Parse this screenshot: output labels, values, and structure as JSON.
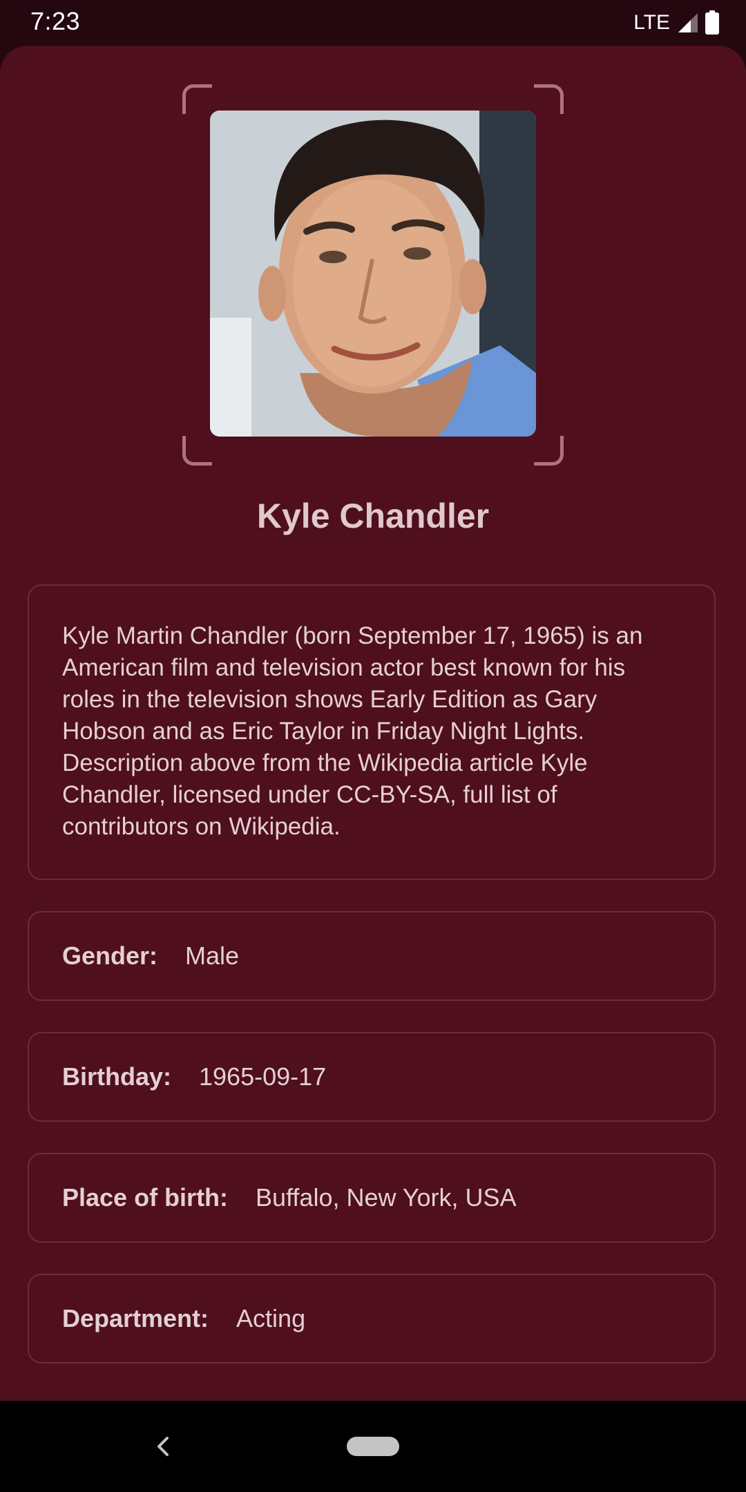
{
  "status_bar": {
    "time": "7:23",
    "network": "LTE",
    "icons": [
      "signal-icon",
      "battery-icon"
    ]
  },
  "person": {
    "name": "Kyle Chandler",
    "photo_alt": "portrait-photo"
  },
  "biography": "Kyle Martin Chandler (born September 17, 1965) is an American film and television actor best known for his roles in the television shows Early Edition as Gary Hobson and as Eric Taylor in Friday Night Lights. Description above from the Wikipedia article Kyle Chandler, licensed under CC-BY-SA, full list of contributors on Wikipedia.",
  "details": [
    {
      "label": "Gender:",
      "value": "Male"
    },
    {
      "label": "Birthday:",
      "value": "1965-09-17"
    },
    {
      "label": "Place of birth:",
      "value": "Buffalo, New York, USA"
    },
    {
      "label": "Department:",
      "value": "Acting"
    }
  ],
  "navigation": {
    "icons": [
      "back-icon",
      "home-pill-icon"
    ]
  },
  "colors": {
    "background": "#4f0f1d",
    "status_bar": "#250710",
    "card_border": "#74283a",
    "frame_accent": "#b0707e",
    "text": "#e4d0d4"
  }
}
